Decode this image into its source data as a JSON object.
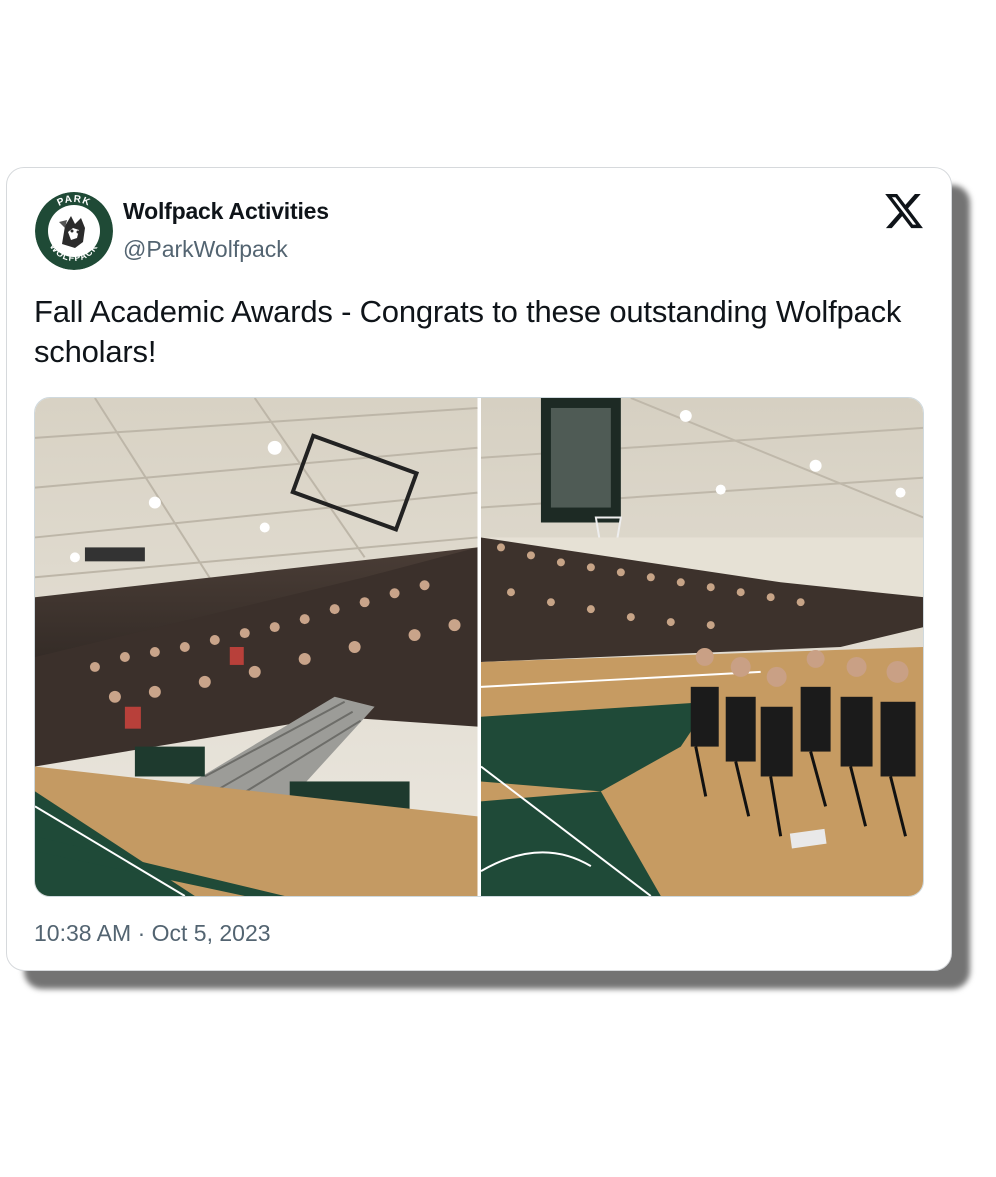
{
  "tweet": {
    "author": {
      "name": "Wolfpack Activities",
      "handle": "@ParkWolfpack",
      "avatar_ring_top": "PARK",
      "avatar_ring_bottom": "WOLFPACK"
    },
    "brand_icon": "x-logo-icon",
    "text": "Fall Academic Awards - Congrats to these outstanding Wolfpack scholars!",
    "timestamp": "10:38 AM · Oct 5, 2023",
    "photos": [
      {
        "description_icon": "gym-bleachers-photo"
      },
      {
        "description_icon": "gym-chairs-photo"
      }
    ]
  },
  "colors": {
    "text_primary": "#0f1419",
    "text_secondary": "#536471",
    "border": "#cfd9de",
    "school_green": "#1d4d3a"
  }
}
